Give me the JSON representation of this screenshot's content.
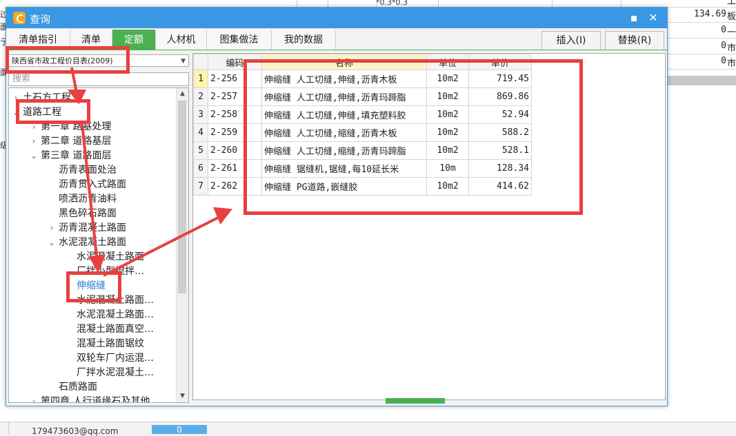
{
  "dialog": {
    "title": "查询",
    "minimize": "▪",
    "close": "✕"
  },
  "tabs": [
    {
      "label": "清单指引"
    },
    {
      "label": "清单"
    },
    {
      "label": "定额"
    },
    {
      "label": "人材机"
    },
    {
      "label": "图集做法"
    },
    {
      "label": "我的数据"
    }
  ],
  "toolbar": {
    "insert_label": "插入(I)",
    "replace_label": "替换(R)"
  },
  "left": {
    "catalog_value": "陕西省市政工程价目表(2009)",
    "search_placeholder": "搜索"
  },
  "tree": [
    {
      "label": "土石方工程",
      "toggle": "›"
    },
    {
      "label": "道路工程",
      "toggle": "⌄"
    },
    {
      "label": "第一章 路基处理",
      "toggle": "›"
    },
    {
      "label": "第二章 道路基层",
      "toggle": "›"
    },
    {
      "label": "第三章 道路面层",
      "toggle": "⌄"
    },
    {
      "label": "沥青表面处治",
      "toggle": ""
    },
    {
      "label": "沥青贯入式路面",
      "toggle": ""
    },
    {
      "label": "喷洒沥青油料",
      "toggle": ""
    },
    {
      "label": "黑色碎石路面",
      "toggle": ""
    },
    {
      "label": "沥青混凝土路面",
      "toggle": "›"
    },
    {
      "label": "水泥混凝土路面",
      "toggle": "⌄"
    },
    {
      "label": "水泥混凝土路面",
      "toggle": ""
    },
    {
      "label": "厂拌小型搅拌…",
      "toggle": ""
    },
    {
      "label": "伸缩缝",
      "toggle": ""
    },
    {
      "label": "水泥混凝土路面…",
      "toggle": ""
    },
    {
      "label": "水泥混凝土路面…",
      "toggle": ""
    },
    {
      "label": "混凝土路面真空…",
      "toggle": ""
    },
    {
      "label": "混凝土路面锯纹",
      "toggle": ""
    },
    {
      "label": "双轮车厂内运混…",
      "toggle": ""
    },
    {
      "label": "厂拌水泥混凝土…",
      "toggle": ""
    },
    {
      "label": "石质路面",
      "toggle": ""
    },
    {
      "label": "第四章 人行道缘石及其他",
      "toggle": "›"
    }
  ],
  "table": {
    "headers": {
      "code": "编码",
      "name": "名称",
      "unit": "单位",
      "price": "单价"
    },
    "rows": [
      {
        "idx": "1",
        "code": "2-256",
        "name": "伸缩缝 人工切缝,伸缝,沥青木板",
        "unit": "10m2",
        "price": "719.45"
      },
      {
        "idx": "2",
        "code": "2-257",
        "name": "伸缩缝 人工切缝,伸缝,沥青玛蹄脂",
        "unit": "10m2",
        "price": "869.86"
      },
      {
        "idx": "3",
        "code": "2-258",
        "name": "伸缩缝 人工切缝,伸缝,填充塑料胶",
        "unit": "10m2",
        "price": "52.94"
      },
      {
        "idx": "4",
        "code": "2-259",
        "name": "伸缩缝 人工切缝,缩缝,沥青木板",
        "unit": "10m2",
        "price": "588.2"
      },
      {
        "idx": "5",
        "code": "2-260",
        "name": "伸缩缝 人工切缝,缩缝,沥青玛蹄脂",
        "unit": "10m2",
        "price": "528.1"
      },
      {
        "idx": "6",
        "code": "2-261",
        "name": "伸缩缝 锯缝机,锯缝,每10延长米",
        "unit": "10m",
        "price": "128.34"
      },
      {
        "idx": "7",
        "code": "2-262",
        "name": "伸缩缝 PG道路,嵌缝胶",
        "unit": "10m2",
        "price": "414.62"
      }
    ]
  },
  "background": {
    "top_cell": "*0.3*0.3",
    "rows": [
      {
        "value": "",
        "tail": "工"
      },
      {
        "value": "134.69",
        "tail": "板"
      },
      {
        "value": "0",
        "tail": "一"
      },
      {
        "value": "0",
        "tail": "市"
      },
      {
        "value": "0",
        "tail": "市"
      }
    ],
    "left_chars": [
      "过",
      "面",
      "亍",
      "面",
      "级"
    ],
    "email": "179473603@qq.com",
    "blue_value": "0"
  },
  "colors": {
    "accent": "#3a97e3",
    "active_tab": "#4cb050",
    "annotation_red": "#e8403f",
    "selected_node": "#2b7fd3"
  }
}
